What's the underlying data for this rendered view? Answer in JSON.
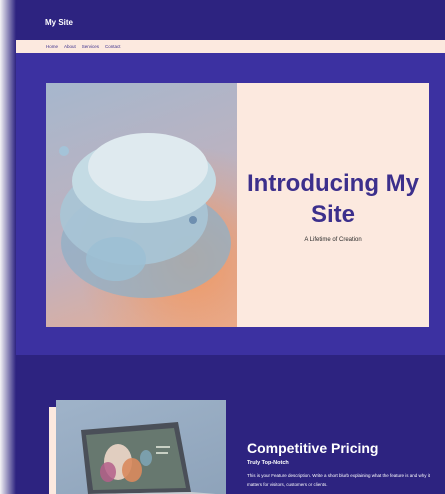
{
  "site": {
    "title": "My Site"
  },
  "nav": {
    "items": [
      {
        "label": "Home"
      },
      {
        "label": "About"
      },
      {
        "label": "Services"
      },
      {
        "label": "Contact"
      }
    ]
  },
  "hero": {
    "heading": "Introducing My Site",
    "subheading": "A Lifetime of Creation"
  },
  "feature": {
    "heading": "Competitive Pricing",
    "subheading": "Truly Top-Notch",
    "description": "This is your Feature description. Write a short blurb explaining what the feature is and why it matters for visitors, customers or clients."
  },
  "colors": {
    "brand": "#2d2380",
    "hero_bg": "#3c31a1",
    "panel_bg": "#fce9df",
    "accent_text": "#3c2f8c"
  },
  "icons": [
    "abstract-sculpture-image",
    "laptop-image"
  ]
}
